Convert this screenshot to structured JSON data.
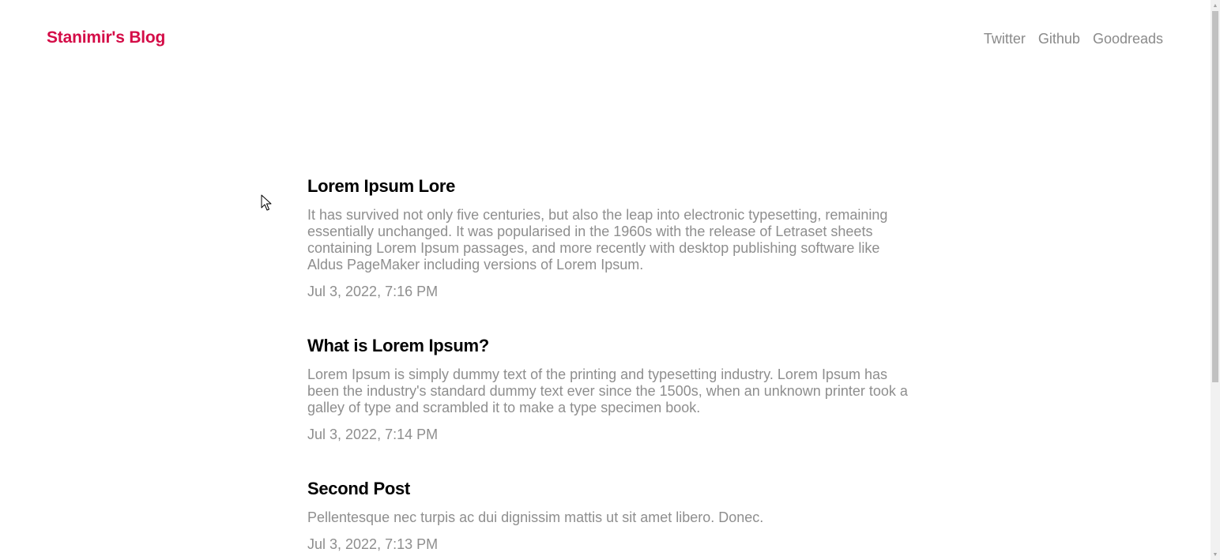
{
  "header": {
    "brand": "Stanimir's Blog",
    "nav": [
      "Twitter",
      "Github",
      "Goodreads"
    ]
  },
  "posts": [
    {
      "title": "Lorem Ipsum Lore",
      "excerpt": "It has survived not only five centuries, but also the leap into electronic typesetting, remaining essentially unchanged. It was popularised in the 1960s with the release of Letraset sheets containing Lorem Ipsum passages, and more recently with desktop publishing software like Aldus PageMaker including versions of Lorem Ipsum.",
      "date": "Jul 3, 2022, 7:16 PM"
    },
    {
      "title": "What is Lorem Ipsum?",
      "excerpt": "Lorem Ipsum is simply dummy text of the printing and typesetting industry. Lorem Ipsum has been the industry's standard dummy text ever since the 1500s, when an unknown printer took a galley of type and scrambled it to make a type specimen book.",
      "date": "Jul 3, 2022, 7:14 PM"
    },
    {
      "title": "Second Post",
      "excerpt": "Pellentesque nec turpis ac dui dignissim mattis ut sit amet libero. Donec.",
      "date": "Jul 3, 2022, 7:13 PM"
    }
  ],
  "colors": {
    "brand": "#d40c47",
    "nav_text": "#8a8a8a",
    "title_text": "#000000",
    "muted_text": "#8e8e8e"
  },
  "icons": {
    "cursor": "mouse-pointer-icon",
    "scroll_up": "scroll-up-arrow-icon",
    "scroll_down": "scroll-down-arrow-icon"
  }
}
